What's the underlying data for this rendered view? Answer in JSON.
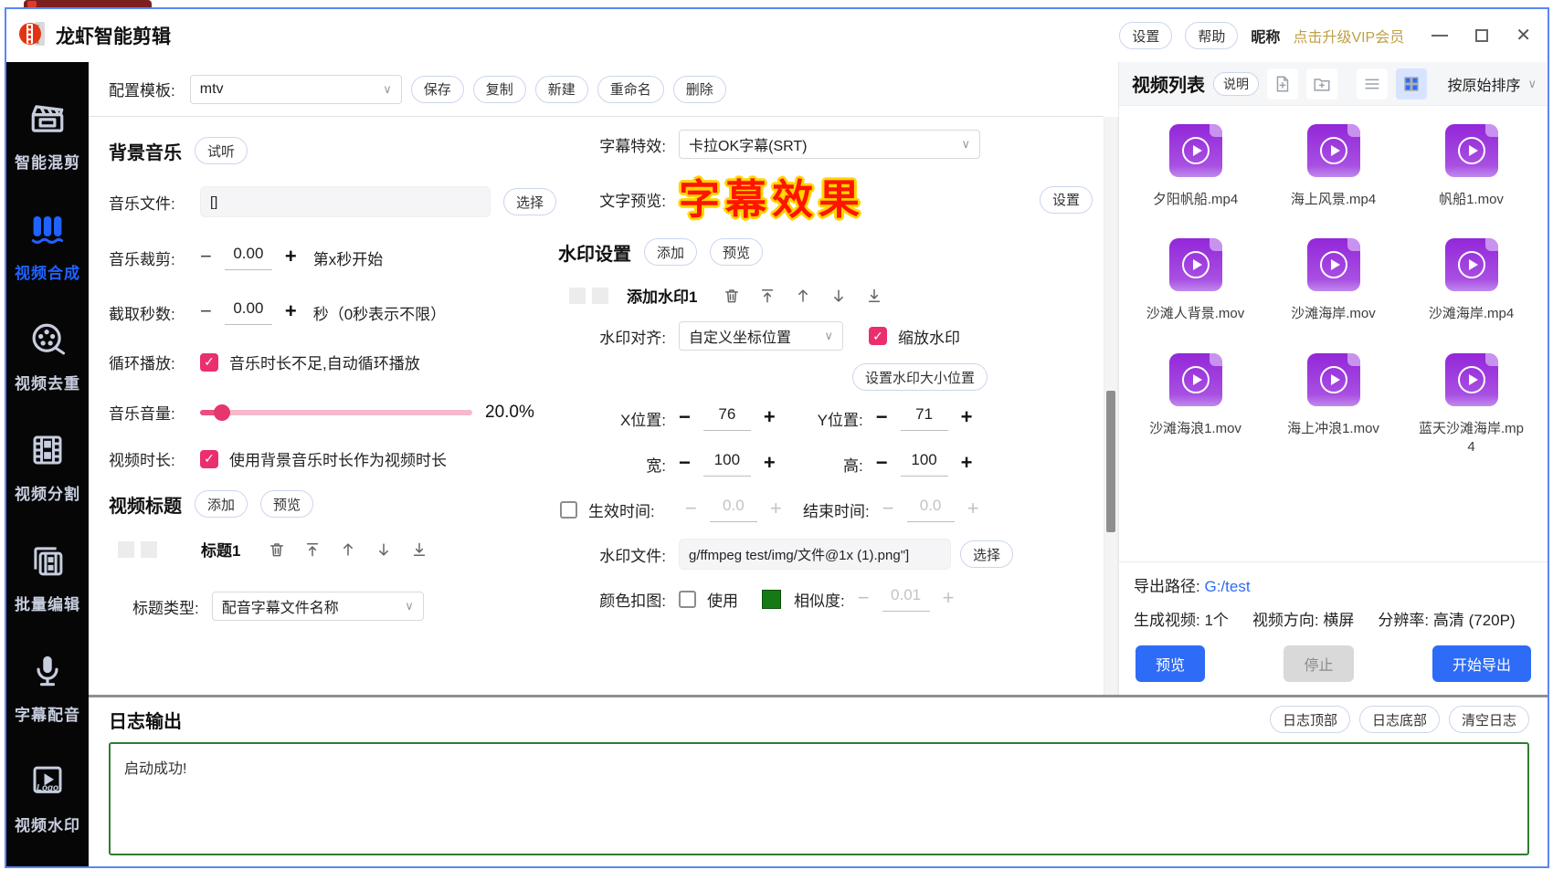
{
  "colors": {
    "accent_blue": "#2E6BF6",
    "pink": "#EB2F6E",
    "purple": "#9B2EDC",
    "gold": "#BFA046",
    "log_border": "#2E7D32",
    "subtitle_red": "#FF1400",
    "subtitle_outline": "#FFD400"
  },
  "titlebar": {
    "app_name": "龙虾智能剪辑",
    "settings": "设置",
    "help": "帮助",
    "nickname": "昵称",
    "vip": "点击升级VIP会员"
  },
  "sidebar": {
    "items": [
      {
        "label": "智能混剪",
        "icon": "clapperboard-icon"
      },
      {
        "label": "视频合成",
        "icon": "stack-icon",
        "active": true
      },
      {
        "label": "视频去重",
        "icon": "film-reel-icon"
      },
      {
        "label": "视频分割",
        "icon": "filmstrip-icon"
      },
      {
        "label": "批量编辑",
        "icon": "frames-icon"
      },
      {
        "label": "字幕配音",
        "icon": "microphone-icon"
      },
      {
        "label": "视频水印",
        "icon": "logo-play-icon"
      }
    ]
  },
  "config": {
    "label": "配置模板:",
    "template": "mtv",
    "save": "保存",
    "copy": "复制",
    "new": "新建",
    "rename": "重命名",
    "delete": "删除"
  },
  "music": {
    "heading": "背景音乐",
    "audition": "试听",
    "file_label": "音乐文件:",
    "file_value": "[]",
    "choose": "选择",
    "trim_label": "音乐裁剪:",
    "trim_value": "0.00",
    "trim_hint": "第x秒开始",
    "cut_label": "截取秒数:",
    "cut_value": "0.00",
    "cut_hint": "秒（0秒表示不限）",
    "loop_label": "循环播放:",
    "loop_text": "音乐时长不足,自动循环播放",
    "volume_label": "音乐音量:",
    "volume_value": "20.0%",
    "duration_label": "视频时长:",
    "duration_text": "使用背景音乐时长作为视频时长"
  },
  "title_section": {
    "heading": "视频标题",
    "add": "添加",
    "preview": "预览",
    "item_name": "标题1",
    "type_label": "标题类型:",
    "type_value": "配音字幕文件名称"
  },
  "subtitle": {
    "effect_label": "字幕特效:",
    "effect_value": "卡拉OK字幕(SRT)",
    "preview_label": "文字预览:",
    "preview_text": "字幕效果",
    "settings": "设置"
  },
  "watermark": {
    "heading": "水印设置",
    "add": "添加",
    "preview": "预览",
    "item_name": "添加水印1",
    "align_label": "水印对齐:",
    "align_value": "自定义坐标位置",
    "scale_text": "缩放水印",
    "size_button": "设置水印大小位置",
    "x_label": "X位置:",
    "x_value": "76",
    "y_label": "Y位置:",
    "y_value": "71",
    "w_label": "宽:",
    "w_value": "100",
    "h_label": "高:",
    "h_value": "100",
    "start_label": "生效时间:",
    "start_value": "0.0",
    "end_label": "结束时间:",
    "end_value": "0.0",
    "file_label": "水印文件:",
    "file_value": "g/ffmpeg test/img/文件@1x (1).png\"]",
    "choose": "选择",
    "chroma_label": "颜色扣图:",
    "use_text": "使用",
    "similarity_label": "相似度:",
    "similarity_value": "0.01"
  },
  "video_list": {
    "title": "视频列表",
    "help": "说明",
    "sort": "按原始排序",
    "files": [
      "夕阳帆船.mp4",
      "海上风景.mp4",
      "帆船1.mov",
      "沙滩人背景.mov",
      "沙滩海岸.mov",
      "沙滩海岸.mp4",
      "沙滩海浪1.mov",
      "海上冲浪1.mov",
      "蓝天沙滩海岸.mp4"
    ],
    "export_label": "导出路径:",
    "export_value": "G:/test",
    "gen_label": "生成视频:",
    "gen_value": "1个",
    "orient_label": "视频方向:",
    "orient_value": "横屏",
    "res_label": "分辨率:",
    "res_value": "高清 (720P)",
    "preview_btn": "预览",
    "stop_btn": "停止",
    "export_btn": "开始导出"
  },
  "log": {
    "heading": "日志输出",
    "top_btn": "日志顶部",
    "bottom_btn": "日志底部",
    "clear_btn": "清空日志",
    "content": "启动成功!"
  }
}
